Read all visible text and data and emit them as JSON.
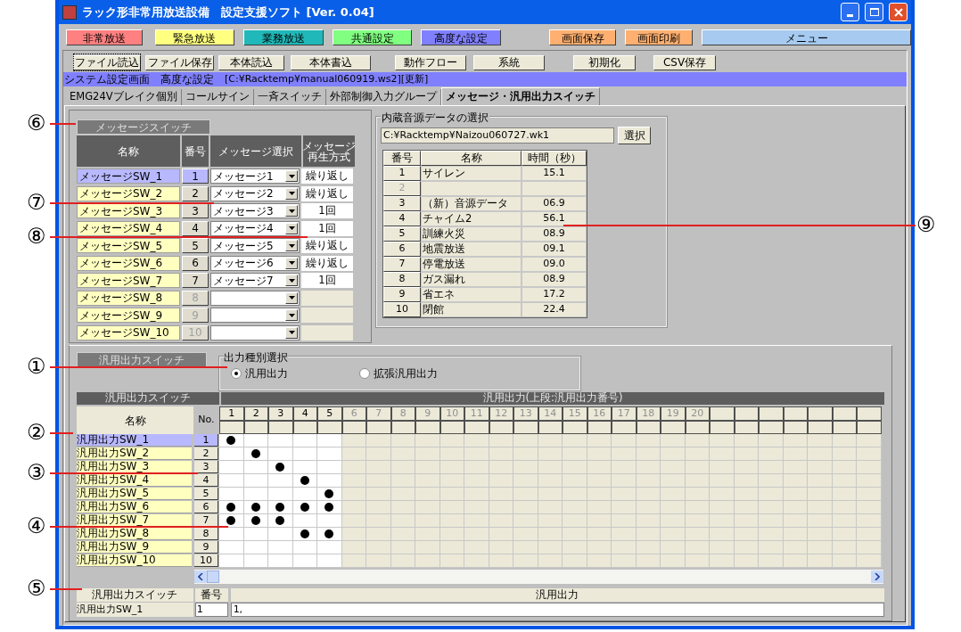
{
  "window": {
    "title": "ラック形非常用放送設備　設定支援ソフト [Ver. 0.04]"
  },
  "nav_buttons": [
    {
      "label": "非常放送",
      "color": "#ff8080"
    },
    {
      "label": "緊急放送",
      "color": "#ffff80"
    },
    {
      "label": "業務放送",
      "color": "#20b8b8"
    },
    {
      "label": "共通設定",
      "color": "#80ff80"
    },
    {
      "label": "高度な設定",
      "color": "#8080ff"
    },
    {
      "label": "画面保存",
      "color": "#ffb070"
    },
    {
      "label": "画面印刷",
      "color": "#ffb070"
    },
    {
      "label": "メニュー",
      "color": "#a6caf0"
    }
  ],
  "toolbar": [
    {
      "label": "ファイル読込",
      "focused": true
    },
    {
      "label": "ファイル保存",
      "focused": false
    },
    {
      "label": "本体読込",
      "focused": false
    },
    {
      "label": "本体書込",
      "focused": false
    },
    {
      "label": "動作フロー",
      "focused": false
    },
    {
      "label": "系統",
      "focused": false
    },
    {
      "label": "初期化",
      "focused": false
    },
    {
      "label": "CSV保存",
      "focused": false
    }
  ],
  "path_bar": {
    "screen": "システム設定画面",
    "mode": "高度な設定",
    "file": "[C:¥Racktemp¥manual060919.ws2][更新]"
  },
  "tabs": [
    {
      "label": "EMG24Vブレイク個別",
      "selected": false
    },
    {
      "label": "コールサイン",
      "selected": false
    },
    {
      "label": "一斉スイッチ",
      "selected": false
    },
    {
      "label": "外部制御入力グループ",
      "selected": false
    },
    {
      "label": "メッセージ・汎用出力スイッチ",
      "selected": true
    }
  ],
  "message_switch": {
    "title": "メッセージスイッチ",
    "columns": [
      [
        "名称"
      ],
      [
        "番号"
      ],
      [
        "メッセージ選択"
      ],
      [
        "メッセージ",
        "再生方式"
      ]
    ],
    "rows": [
      {
        "name": "メッセージSW_1",
        "no": "1",
        "message": "メッセージ1",
        "mode": "繰り返し",
        "selected": true,
        "enabled": true
      },
      {
        "name": "メッセージSW_2",
        "no": "2",
        "message": "メッセージ2",
        "mode": "繰り返し",
        "selected": false,
        "enabled": true
      },
      {
        "name": "メッセージSW_3",
        "no": "3",
        "message": "メッセージ3",
        "mode": "1回",
        "selected": false,
        "enabled": true
      },
      {
        "name": "メッセージSW_4",
        "no": "4",
        "message": "メッセージ4",
        "mode": "1回",
        "selected": false,
        "enabled": true
      },
      {
        "name": "メッセージSW_5",
        "no": "5",
        "message": "メッセージ5",
        "mode": "繰り返し",
        "selected": false,
        "enabled": true
      },
      {
        "name": "メッセージSW_6",
        "no": "6",
        "message": "メッセージ6",
        "mode": "繰り返し",
        "selected": false,
        "enabled": true
      },
      {
        "name": "メッセージSW_7",
        "no": "7",
        "message": "メッセージ7",
        "mode": "1回",
        "selected": false,
        "enabled": true
      },
      {
        "name": "メッセージSW_8",
        "no": "8",
        "selected": false,
        "enabled": false
      },
      {
        "name": "メッセージSW_9",
        "no": "9",
        "selected": false,
        "enabled": false
      },
      {
        "name": "メッセージSW_10",
        "no": "10",
        "selected": false,
        "enabled": false
      }
    ]
  },
  "sound_data": {
    "title": "内蔵音源データの選択",
    "path": "C:¥Racktemp¥Naizou060727.wk1",
    "select_button": "選択",
    "columns": [
      "番号",
      "名称",
      "時間（秒）"
    ],
    "rows": [
      {
        "no": "1",
        "name": "サイレン",
        "time": "15.1",
        "enabled": true
      },
      {
        "no": "2",
        "enabled": false
      },
      {
        "no": "3",
        "name": "（新）音源データ",
        "time": "06.9",
        "enabled": true
      },
      {
        "no": "4",
        "name": "チャイム2",
        "time": "56.1",
        "enabled": true
      },
      {
        "no": "5",
        "name": "訓練火災",
        "time": "08.9",
        "enabled": true
      },
      {
        "no": "6",
        "name": "地震放送",
        "time": "09.1",
        "enabled": true
      },
      {
        "no": "7",
        "name": "停電放送",
        "time": "09.0",
        "enabled": true
      },
      {
        "no": "8",
        "name": "ガス漏れ",
        "time": "08.9",
        "enabled": true
      },
      {
        "no": "9",
        "name": "省エネ",
        "time": "17.2",
        "enabled": true
      },
      {
        "no": "10",
        "name": "閉館",
        "time": "22.4",
        "enabled": true
      }
    ]
  },
  "output_section": {
    "title": "汎用出力スイッチ",
    "type_group": {
      "title": "出力種別選択",
      "options": [
        {
          "label": "汎用出力",
          "selected": true
        },
        {
          "label": "拡張汎用出力",
          "selected": false
        }
      ]
    },
    "grid": {
      "left_title": "汎用出力スイッチ",
      "right_title": "汎用出力(上段:汎用出力番号)",
      "name_header": "名称",
      "no_header": "No.",
      "columns": [
        {
          "label": "1",
          "enabled": true
        },
        {
          "label": "2",
          "enabled": true
        },
        {
          "label": "3",
          "enabled": true
        },
        {
          "label": "4",
          "enabled": true
        },
        {
          "label": "5",
          "enabled": true
        },
        {
          "label": "6",
          "enabled": false
        },
        {
          "label": "7",
          "enabled": false
        },
        {
          "label": "8",
          "enabled": false
        },
        {
          "label": "9",
          "enabled": false
        },
        {
          "label": "10",
          "enabled": false
        },
        {
          "label": "11",
          "enabled": false
        },
        {
          "label": "12",
          "enabled": false
        },
        {
          "label": "13",
          "enabled": false
        },
        {
          "label": "14",
          "enabled": false
        },
        {
          "label": "15",
          "enabled": false
        },
        {
          "label": "16",
          "enabled": false
        },
        {
          "label": "17",
          "enabled": false
        },
        {
          "label": "18",
          "enabled": false
        },
        {
          "label": "19",
          "enabled": false
        },
        {
          "label": "20",
          "enabled": false
        }
      ],
      "rows": [
        {
          "name": "汎用出力SW_1",
          "no": "1",
          "selected": true,
          "outputs": [
            true,
            false,
            false,
            false,
            false
          ]
        },
        {
          "name": "汎用出力SW_2",
          "no": "2",
          "selected": false,
          "outputs": [
            false,
            true,
            false,
            false,
            false
          ]
        },
        {
          "name": "汎用出力SW_3",
          "no": "3",
          "selected": false,
          "outputs": [
            false,
            false,
            true,
            false,
            false
          ]
        },
        {
          "name": "汎用出力SW_4",
          "no": "4",
          "selected": false,
          "outputs": [
            false,
            false,
            false,
            true,
            false
          ]
        },
        {
          "name": "汎用出力SW_5",
          "no": "5",
          "selected": false,
          "outputs": [
            false,
            false,
            false,
            false,
            true
          ]
        },
        {
          "name": "汎用出力SW_6",
          "no": "6",
          "selected": false,
          "outputs": [
            true,
            true,
            true,
            true,
            true
          ]
        },
        {
          "name": "汎用出力SW_7",
          "no": "7",
          "selected": false,
          "outputs": [
            true,
            true,
            true,
            false,
            false
          ]
        },
        {
          "name": "汎用出力SW_8",
          "no": "8",
          "selected": false,
          "outputs": [
            false,
            false,
            false,
            true,
            true
          ]
        },
        {
          "name": "汎用出力SW_9",
          "no": "9",
          "selected": false,
          "outputs": [
            false,
            false,
            false,
            false,
            false
          ]
        },
        {
          "name": "汎用出力SW_10",
          "no": "10",
          "selected": false,
          "outputs": [
            false,
            false,
            false,
            false,
            false
          ]
        }
      ]
    },
    "detail": {
      "columns": [
        "汎用出力スイッチ",
        "番号",
        "汎用出力"
      ],
      "name": "汎用出力SW_1",
      "no": "1",
      "outputs": "1,"
    }
  },
  "callouts": [
    {
      "label": "⑥"
    },
    {
      "label": "⑦"
    },
    {
      "label": "⑧"
    },
    {
      "label": "⑨"
    },
    {
      "label": "①"
    },
    {
      "label": "②"
    },
    {
      "label": "③"
    },
    {
      "label": "④"
    },
    {
      "label": "⑤"
    }
  ]
}
